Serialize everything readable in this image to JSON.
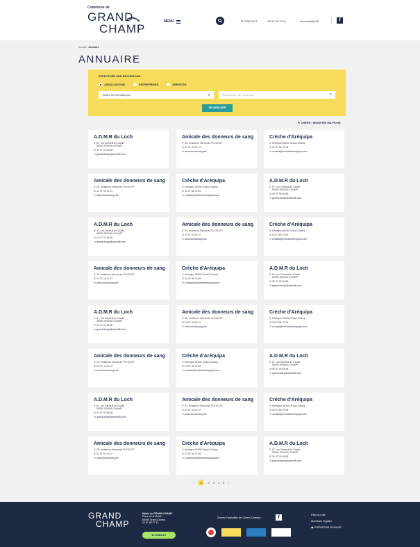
{
  "header": {
    "logo_small": "Commune de",
    "logo_grand": "GRAND",
    "logo_champ": "CHAMP",
    "menu_label": "MENU",
    "contact_label": "CONTACT",
    "phone": "02 97 66 77 11",
    "accessibility_label": "Accessibilité"
  },
  "breadcrumb": {
    "home": "Accueil",
    "current": "Annuaire"
  },
  "page_title": "ANNUAIRE",
  "search_panel": {
    "title": "EFFECTUER UNE RECHERCHE :",
    "radios": [
      {
        "label": "ASSOCIATIONS",
        "checked": true
      },
      {
        "label": "ENTREPRISES",
        "checked": false
      },
      {
        "label": "SERVICES",
        "checked": false
      }
    ],
    "theme_select_value": "Toutes les thématiques",
    "keyword_placeholder": "Rechercher par mots-clés",
    "submit_label": "RECHERCHER"
  },
  "create_link": "CRÉER / MODIFIER MA FICHE",
  "entries": {
    "adm": {
      "title": "A.D.M.R du Loch",
      "addr1": "67, rue Général de Gaulle",
      "addr2": "56390 GRAND-CHAMP",
      "phone": "02 97 03 65 85",
      "link": "grandchamp@admr56.com"
    },
    "amicale": {
      "title": "Amicale des donneurs de sang",
      "addr1": "25, résidence Harmonie PLESCOP",
      "addr2": "",
      "phone": "02 97 43 40 37",
      "link": "www.dondusang.net"
    },
    "creche": {
      "title": "Crèche d'Aréquipa",
      "addr1": "Kerlegun 56390 Grand-Champ",
      "addr2": "",
      "phone": "02 97 66 75 69",
      "link": "contact@crecheinterequipa.com"
    }
  },
  "grid": [
    [
      "adm",
      "amicale",
      "creche"
    ],
    [
      "amicale",
      "creche",
      "adm"
    ],
    [
      "adm",
      "amicale",
      "creche"
    ],
    [
      "amicale",
      "creche",
      "adm"
    ],
    [
      "adm",
      "amicale",
      "creche"
    ],
    [
      "amicale",
      "creche",
      "adm"
    ],
    [
      "adm",
      "amicale",
      "creche"
    ],
    [
      "amicale",
      "creche",
      "adm"
    ]
  ],
  "pagination": {
    "prev": "‹",
    "pages": [
      "1",
      "2",
      "3",
      "4",
      "5"
    ],
    "current": "1",
    "next": "›"
  },
  "footer": {
    "logo_grand": "GRAND",
    "logo_champ": "CHAMP",
    "mairie_title": "Mairie de GRAND-CHAMP",
    "addr1": "Place de la Mairie",
    "addr2": "56390 Grand-Champ",
    "phone": "02 97 66 77 11",
    "contact_label": "CONTACT",
    "follow_label": "Suivez l'actualité de Grand-Champ :",
    "links": [
      "Plan du site",
      "Mentions légales",
      "CRÉATEUR D'IMAGE"
    ]
  },
  "colors": {
    "navy": "#1d2a44",
    "yellow": "#f7db5b",
    "teal": "#2a9d9a",
    "green": "#a9e36a"
  }
}
